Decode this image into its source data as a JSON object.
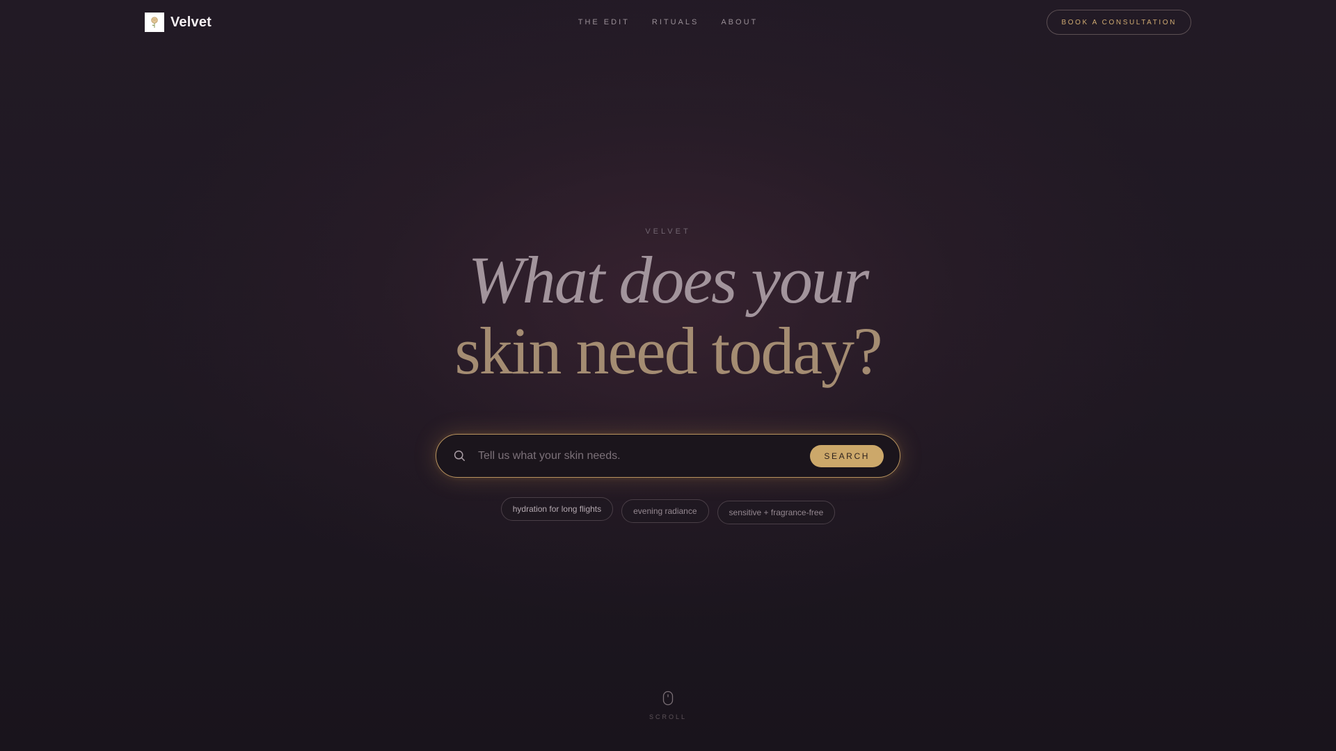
{
  "brand": {
    "name": "Velvet",
    "logo_icon": "rose-icon"
  },
  "nav": {
    "items": [
      {
        "label": "THE EDIT"
      },
      {
        "label": "RITUALS"
      },
      {
        "label": "ABOUT"
      }
    ]
  },
  "header": {
    "cta_label": "BOOK A CONSULTATION"
  },
  "hero": {
    "eyebrow": "VELVET",
    "headline_line1": "What does your",
    "headline_line2": "skin need today?"
  },
  "search": {
    "icon": "search-icon",
    "placeholder": "Tell us what your skin needs.",
    "value": "",
    "button_label": "SEARCH"
  },
  "suggestions": [
    {
      "label": "hydration for long flights"
    },
    {
      "label": "evening radiance"
    },
    {
      "label": "sensitive + fragrance-free"
    }
  ],
  "scroll": {
    "icon": "mouse-icon",
    "label": "SCROLL"
  },
  "colors": {
    "background": "#201922",
    "accent_gold": "#cca86a",
    "cta_text": "#d0ab72",
    "headline_top": "#a2949c",
    "headline_bottom": "#a48c72"
  }
}
